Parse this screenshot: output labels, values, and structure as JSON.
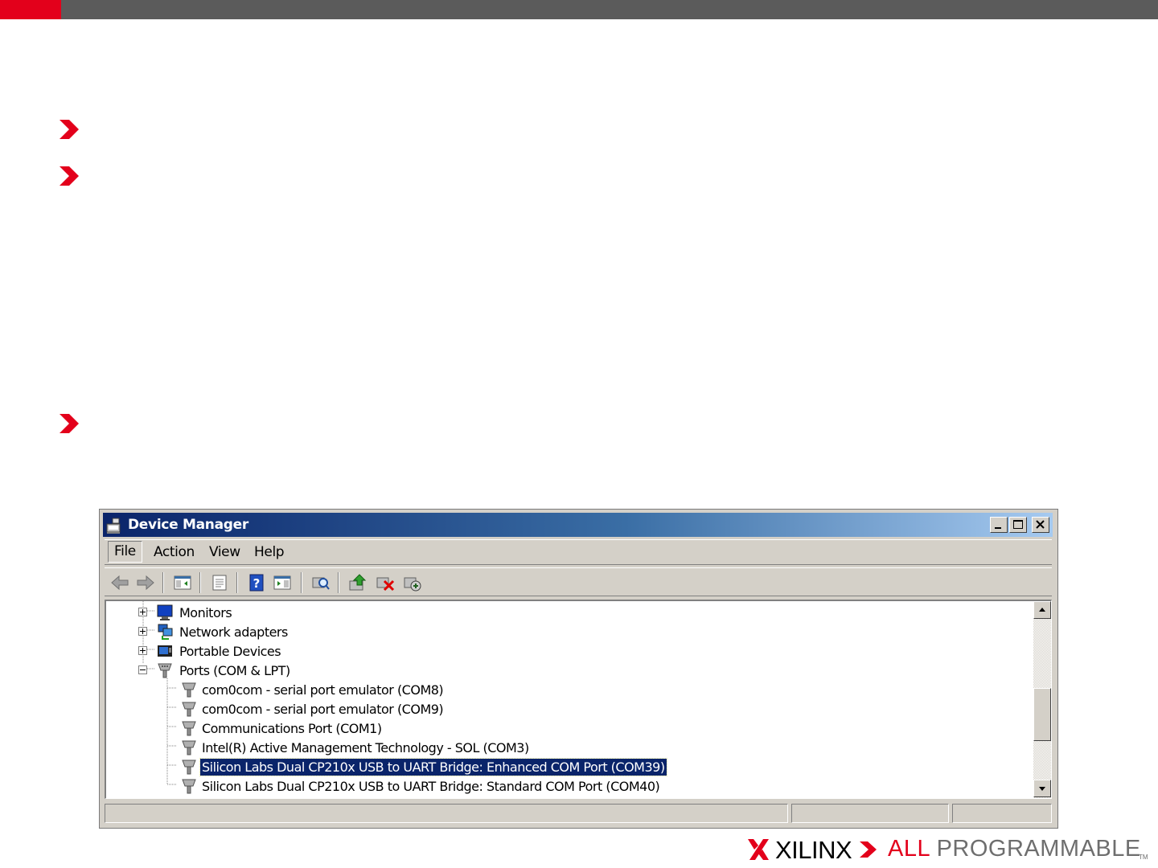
{
  "colors": {
    "brand_red": "#e3001b",
    "top_bar": "#5b5b5b",
    "title_gradient_start": "#0a246a",
    "selection": "#0a246a"
  },
  "window": {
    "title": "Device Manager",
    "caption_buttons": [
      "minimize-icon",
      "maximize-icon",
      "close-icon"
    ]
  },
  "menubar": {
    "items": [
      "File",
      "Action",
      "View",
      "Help"
    ]
  },
  "toolbar": {
    "buttons": [
      "back-icon",
      "forward-icon",
      "show-hide-console-tree-icon",
      "properties-icon",
      "help-icon",
      "show-action-pane-icon",
      "scan-hardware-icon",
      "update-driver-icon",
      "uninstall-icon",
      "disable-device-icon"
    ]
  },
  "tree": {
    "categories": [
      {
        "label": "Monitors",
        "expanded": false,
        "icon": "monitor-icon"
      },
      {
        "label": "Network adapters",
        "expanded": false,
        "icon": "network-adapter-icon"
      },
      {
        "label": "Portable Devices",
        "expanded": false,
        "icon": "portable-device-icon"
      },
      {
        "label": "Ports (COM & LPT)",
        "expanded": true,
        "icon": "port-icon"
      }
    ],
    "ports": [
      {
        "label": "com0com - serial port emulator (COM8)",
        "selected": false
      },
      {
        "label": "com0com - serial port emulator (COM9)",
        "selected": false
      },
      {
        "label": "Communications Port (COM1)",
        "selected": false
      },
      {
        "label": "Intel(R) Active Management Technology - SOL (COM3)",
        "selected": false
      },
      {
        "label": "Silicon Labs Dual CP210x USB to UART Bridge: Enhanced COM Port (COM39)",
        "selected": true
      },
      {
        "label": "Silicon Labs Dual CP210x USB to UART Bridge: Standard COM Port (COM40)",
        "selected": false
      }
    ]
  },
  "footer": {
    "brand": "XILINX",
    "tagline_highlight": "ALL",
    "tagline_rest": "PROGRAMMABLE",
    "trademark": "TM"
  }
}
